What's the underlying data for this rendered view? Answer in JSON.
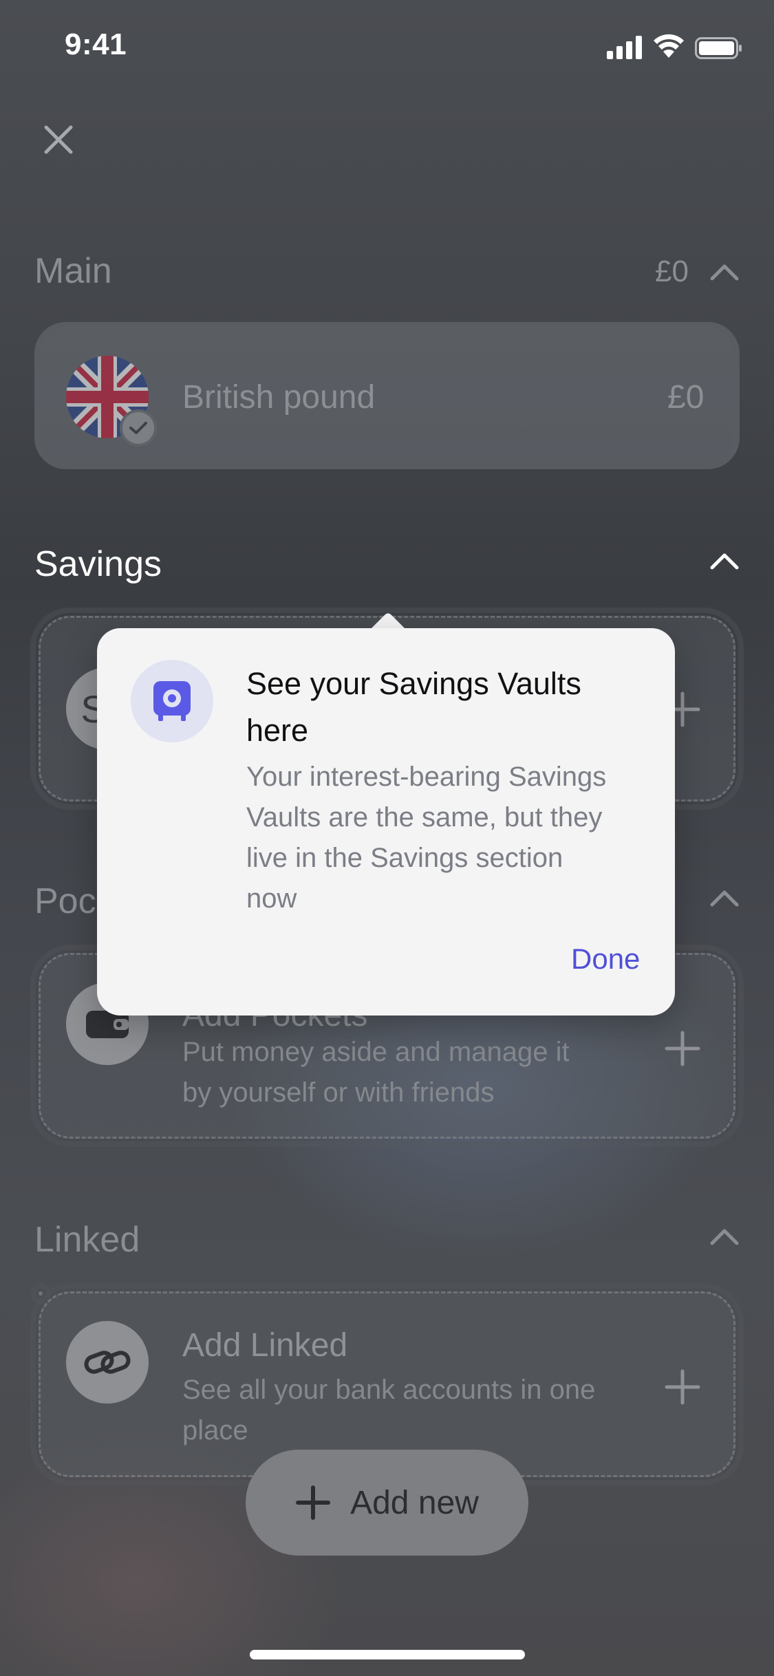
{
  "status_bar": {
    "time": "9:41"
  },
  "sections": {
    "main": {
      "title": "Main",
      "total": "£0",
      "account_name": "British pound",
      "account_balance": "£0"
    },
    "savings": {
      "title": "Savings",
      "hidden_letter": "S"
    },
    "pockets": {
      "title": "Poc",
      "card_title": "Add Pockets",
      "card_sub_1": "Put money aside and manage it",
      "card_sub_2": "by yourself or with friends"
    },
    "linked": {
      "title": "Linked",
      "card_title": "Add Linked",
      "card_sub_1": "See all your bank accounts in one",
      "card_sub_2": "place"
    }
  },
  "tooltip": {
    "title_1": "See your Savings Vaults",
    "title_2": "here",
    "body_1": "Your interest-bearing Savings",
    "body_2": "Vaults are the same, but they",
    "body_3": "live in the Savings section",
    "body_4": "now",
    "done_label": "Done"
  },
  "add_new_label": "Add new",
  "colors": {
    "accent": "#5050d8",
    "tooltip_bg": "#f4f4f5",
    "vault_icon": "#5a5ae6"
  }
}
